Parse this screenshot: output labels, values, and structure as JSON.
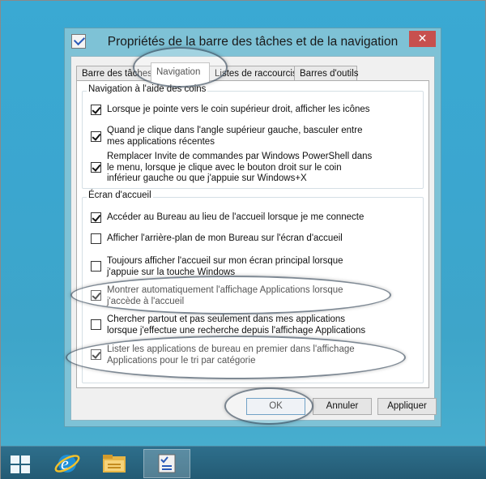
{
  "window": {
    "title": "Propriétés de la barre des tâches et de la navigation",
    "close_glyph": "✕"
  },
  "tabs": [
    {
      "label": "Barre des tâches"
    },
    {
      "label": "Navigation"
    },
    {
      "label": "Listes de raccourcis"
    },
    {
      "label": "Barres d'outils"
    }
  ],
  "corner_group": {
    "title": "Navigation à l'aide des coins",
    "options": [
      {
        "label": "Lorsque je pointe vers le coin supérieur droit, afficher les icônes",
        "checked": true
      },
      {
        "label": "Quand je clique dans l'angle supérieur gauche, basculer entre mes applications récentes",
        "checked": true
      },
      {
        "label": "Remplacer Invite de commandes par Windows PowerShell dans le menu, lorsque je clique avec le bouton droit sur le coin inférieur gauche ou que j'appuie sur Windows+X",
        "checked": true
      }
    ]
  },
  "start_group": {
    "title": "Écran d'accueil",
    "options": [
      {
        "label": "Accéder au Bureau au lieu de l'accueil lorsque je me connecte",
        "checked": true
      },
      {
        "label": "Afficher l'arrière-plan de mon Bureau sur l'écran d'accueil",
        "checked": false
      },
      {
        "label": "Toujours afficher l'accueil sur mon écran principal lorsque j'appuie sur la touche Windows",
        "checked": false
      },
      {
        "label": "Montrer automatiquement l'affichage Applications lorsque j'accède à l'accueil",
        "checked": true
      },
      {
        "label": "Chercher partout et pas seulement dans mes applications lorsque j'effectue une recherche depuis l'affichage Applications",
        "checked": false
      },
      {
        "label": "Lister les applications de bureau en premier dans l'affichage Applications pour le tri par catégorie",
        "checked": true
      }
    ]
  },
  "buttons": {
    "ok": "OK",
    "cancel": "Annuler",
    "apply": "Appliquer"
  },
  "taskbar": {
    "items": [
      {
        "icon": "windows-start-icon"
      },
      {
        "icon": "internet-explorer-icon"
      },
      {
        "icon": "file-explorer-icon"
      },
      {
        "icon": "taskbar-properties-icon",
        "active": true
      }
    ]
  },
  "colors": {
    "accent": "#3ba6cf",
    "close": "#c7504e",
    "taskbar": "#2a6680"
  }
}
